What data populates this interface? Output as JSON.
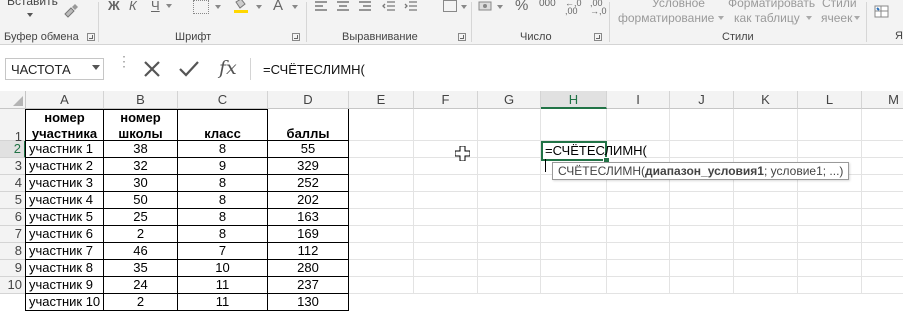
{
  "ribbon": {
    "paste_label": "Вставить",
    "format_buttons": [
      "Ж",
      "К",
      "Ч"
    ],
    "percent_symbol": "%",
    "number_format": "000",
    "styles": {
      "conditional_line1": "Условное",
      "conditional_line2": "форматирование",
      "as_table_line1": "Форматировать",
      "as_table_line2": "как таблицу",
      "cell_styles_line1": "Стили",
      "cell_styles_line2": "ячеек"
    },
    "cut_letter": "Я",
    "groups": {
      "clipboard": "Буфер обмена",
      "font": "Шрифт",
      "alignment": "Выравнивание",
      "number": "Число",
      "styles": "Стили"
    }
  },
  "formula_bar": {
    "name_box": "ЧАСТОТА",
    "formula": "=СЧЁТЕСЛИМН("
  },
  "columns": [
    "A",
    "B",
    "C",
    "D",
    "E",
    "F",
    "G",
    "H",
    "I",
    "J",
    "K",
    "L",
    "M"
  ],
  "rows": [
    "1",
    "2",
    "3",
    "4",
    "5",
    "6",
    "7",
    "8",
    "9",
    "10"
  ],
  "table": {
    "header": {
      "a_line1": "номер",
      "a_line2": "участника",
      "b_line1": "номер",
      "b_line2": "школы",
      "c": "класс",
      "d": "баллы"
    },
    "data": [
      [
        "участник 1",
        "38",
        "8",
        "55"
      ],
      [
        "участник 2",
        "32",
        "9",
        "329"
      ],
      [
        "участник 3",
        "30",
        "8",
        "252"
      ],
      [
        "участник 4",
        "50",
        "8",
        "202"
      ],
      [
        "участник 5",
        "25",
        "8",
        "163"
      ],
      [
        "участник 6",
        "2",
        "8",
        "169"
      ],
      [
        "участник 7",
        "46",
        "7",
        "112"
      ],
      [
        "участник 8",
        "35",
        "10",
        "280"
      ],
      [
        "участник 9",
        "24",
        "11",
        "237"
      ],
      [
        "участник 10",
        "2",
        "11",
        "130"
      ]
    ]
  },
  "active_cell": {
    "ref": "H2",
    "content": "=СЧЁТЕСЛИМН("
  },
  "tooltip": {
    "func": "СЧЁТЕСЛИМН(",
    "arg_bold": "диапазон_условия1",
    "rest": "; условие1; ...)"
  },
  "colors": {
    "accent": "#217346",
    "ribbon_bg": "#f3f3f3",
    "grid_line": "#e3e3e3"
  }
}
